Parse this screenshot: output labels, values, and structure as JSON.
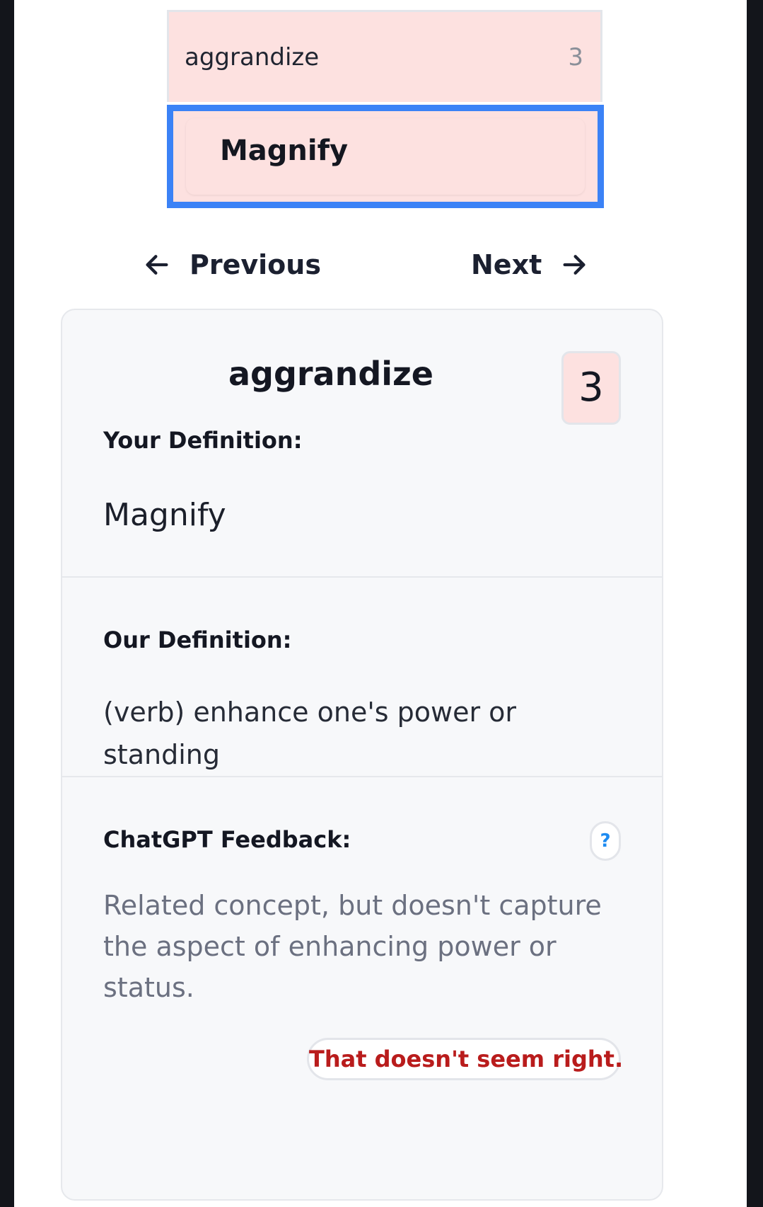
{
  "entry": {
    "word": "aggrandize",
    "count": "3",
    "definition_value": "Magnify"
  },
  "nav": {
    "previous_label": "Previous",
    "next_label": "Next"
  },
  "card": {
    "title": "aggrandize",
    "score": "3",
    "your_definition_label": "Your Definition:",
    "your_definition": "Magnify",
    "our_definition_label": "Our Definition:",
    "our_definition": "(verb) enhance one's power or standing",
    "feedback_label": "ChatGPT Feedback:",
    "help_label": "?",
    "feedback_text": "Related concept, but doesn't capture the aspect of enhancing power or status.",
    "report_label": "That doesn't seem right."
  },
  "colors": {
    "accent_blue": "#3b82f6",
    "row_pink": "#fde1e0",
    "report_red": "#b91c1c",
    "help_blue": "#1d8bf1"
  },
  "icons": {
    "previous": "arrow-left-icon",
    "next": "arrow-right-icon",
    "help": "question-icon"
  }
}
